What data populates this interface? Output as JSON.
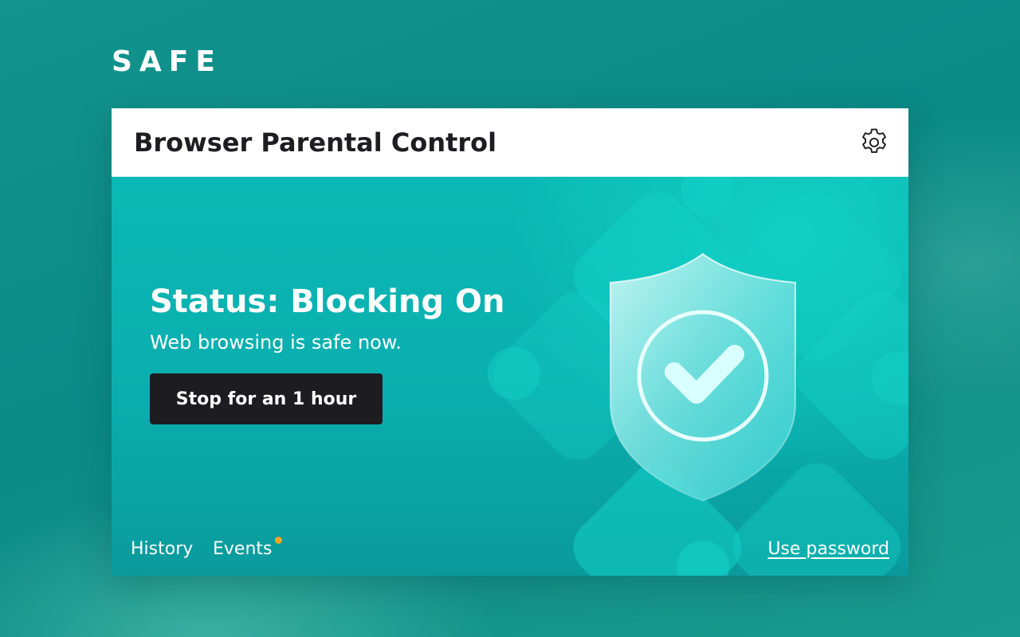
{
  "brand": {
    "name": "SAFE"
  },
  "header": {
    "title": "Browser Parental Control",
    "settings_icon": "gear-icon"
  },
  "status": {
    "title": "Status: Blocking On",
    "subtitle": "Web browsing is safe now."
  },
  "actions": {
    "stop_label": "Stop for an 1 hour"
  },
  "footer": {
    "history_label": "History",
    "events_label": "Events",
    "events_has_notification": true,
    "password_label": "Use password"
  },
  "illustration": {
    "icon": "shield-check-icon"
  },
  "colors": {
    "accent": "#0ab5b3",
    "background": "#0e8f8b",
    "button": "#1c1c21",
    "notification_dot": "#f5a623",
    "text_dark": "#1d1d22",
    "text_light": "#ffffff"
  }
}
